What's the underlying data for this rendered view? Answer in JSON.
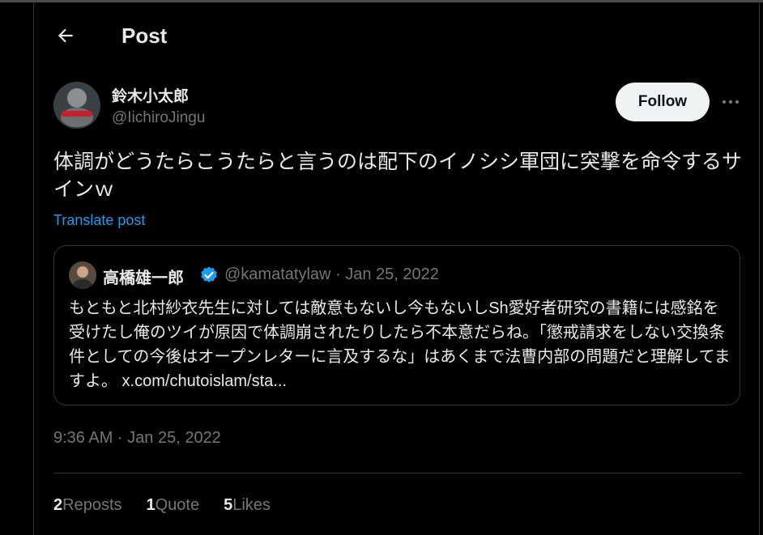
{
  "header": {
    "title": "Post",
    "back_icon": "arrow-left-icon"
  },
  "post": {
    "author": {
      "name": "鈴木小太郎",
      "handle": "@IichiroJingu"
    },
    "follow_label": "Follow",
    "more_icon": "ellipsis-icon",
    "text": "体調がどうたらこうたらと言うのは配下のイノシシ軍団に突撃を命令するサインｗ",
    "translate_label": "Translate post",
    "timestamp": "9:36 AM · Jan 25, 2022"
  },
  "quote": {
    "name": "高橋雄一郎",
    "verified_icon": "verified-badge-icon",
    "meta": "@kamatatylaw · Jan 25, 2022",
    "text": "もともと北村紗衣先生に対しては敵意もないし今もないしSh愛好者研究の書籍には感銘を受けたし俺のツイが原因で体調崩されたりしたら不本意だらね。「懲戒請求をしない交換条件としての今後はオープンレターに言及するな」はあくまで法曹内部の問題だと理解してますよ。 x.com/chutoislam/sta..."
  },
  "stats": [
    {
      "count": "2",
      "label": "Reposts"
    },
    {
      "count": "1",
      "label": "Quote"
    },
    {
      "count": "5",
      "label": "Likes"
    }
  ],
  "colors": {
    "accent": "#1d9bf0",
    "background": "#000000",
    "text": "#e7e9ea",
    "muted": "#71767b",
    "border": "#2f3336"
  }
}
